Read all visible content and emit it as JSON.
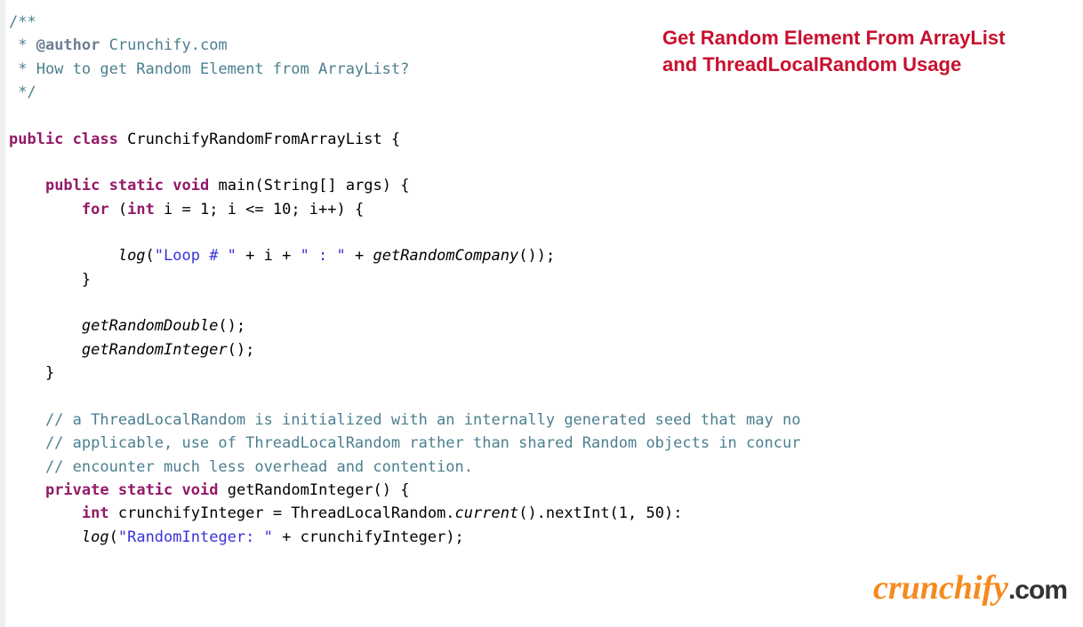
{
  "callout": {
    "line1": "Get Random Element From ArrayList",
    "line2": "and ThreadLocalRandom Usage"
  },
  "watermark": {
    "brand": "crunchify",
    "tld": ".com"
  },
  "code": {
    "l1": "/**",
    "l2a": " * ",
    "l2b": "@author",
    "l2c": " Crunchify.com",
    "l3": " * How to get Random Element from ArrayList?",
    "l4": " */",
    "blank1": "",
    "l5_kw1": "public",
    "l5_kw2": "class",
    "l5_name": "CrunchifyRandomFromArrayList",
    "l5_brace": " {",
    "blank2": "",
    "l6_kw1": "public",
    "l6_kw2": "static",
    "l6_kw3": "void",
    "l6_name": "main",
    "l6_paren_open": "(",
    "l6_arg": "String[] args",
    "l6_paren_close": ") {",
    "l7_kw": "for",
    "l7_open": " (",
    "l7_int": "int",
    "l7_rest": " i = 1; i <= 10; i++) {",
    "blank3": "",
    "l8_pad": "            ",
    "l8_call": "log",
    "l8_popen": "(",
    "l8_s1": "\"Loop # \"",
    "l8_plus1": " + i + ",
    "l8_s2": "\" : \"",
    "l8_plus2": " + ",
    "l8_call2": "getRandomCompany",
    "l8_end": "());",
    "l9": "        }",
    "blank4": "",
    "l10_pad": "        ",
    "l10_call": "getRandomDouble",
    "l10_end": "();",
    "l11_pad": "        ",
    "l11_call": "getRandomInteger",
    "l11_end": "();",
    "l12": "    }",
    "blank5": "",
    "l13": "    // a ThreadLocalRandom is initialized with an internally generated seed that may no",
    "l14": "    // applicable, use of ThreadLocalRandom rather than shared Random objects in concur",
    "l15": "    // encounter much less overhead and contention.",
    "l16_kw1": "private",
    "l16_kw2": "static",
    "l16_kw3": "void",
    "l16_name": "getRandomInteger",
    "l16_end": "() {",
    "l17_pad": "        ",
    "l17_int": "int",
    "l17_var": " crunchifyInteger = ThreadLocalRandom.",
    "l17_cur": "current",
    "l17_rest": "().nextInt(1, 50):",
    "l18_pad": "        ",
    "l18_call": "log",
    "l18_popen": "(",
    "l18_str": "\"RandomInteger: \"",
    "l18_rest": " + crunchifyInteger);"
  }
}
